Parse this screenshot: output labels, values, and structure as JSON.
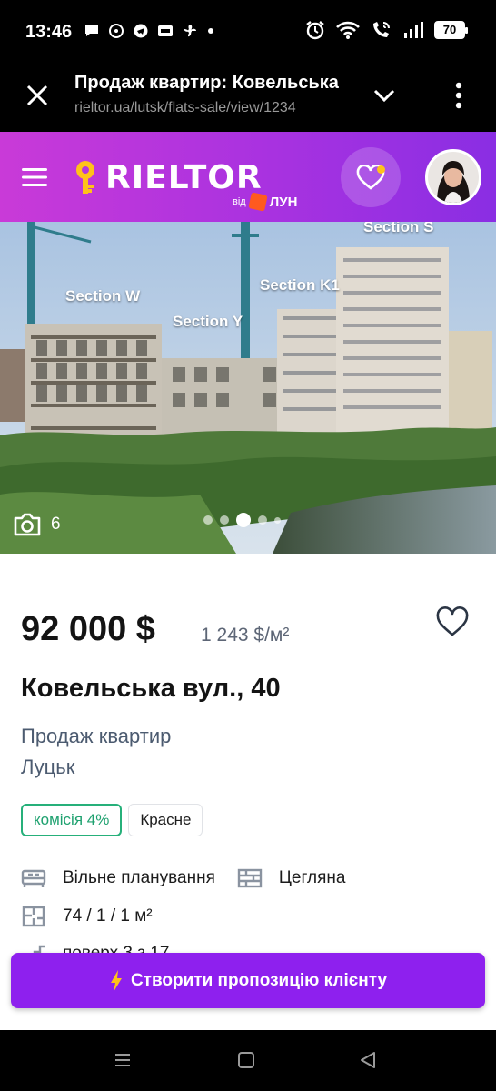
{
  "status_bar": {
    "time": "13:46",
    "battery": "70",
    "left_icons": [
      "chat-bubble-icon",
      "viber-icon",
      "telegram-icon",
      "app-icon",
      "fan-icon",
      "dot-icon"
    ],
    "right_icons": [
      "alarm-icon",
      "wifi-icon",
      "wifi-call-icon",
      "signal-icon"
    ]
  },
  "browser": {
    "title": "Продаж квартир: Ковельська",
    "url": "rieltor.ua/lutsk/flats-sale/view/1234"
  },
  "header": {
    "logo_text": "RIELTOR",
    "logo_sub_prefix": "від",
    "logo_sub_brand": "ЛУН",
    "accent_color": "#a832e0",
    "favorite_dot_color": "#ffc21a"
  },
  "photo": {
    "count": "6",
    "labels": [
      "Section W",
      "Section Y",
      "Section K1",
      "Section S"
    ],
    "active_slide": 3,
    "total_dots": 5
  },
  "listing": {
    "price": "92 000 $",
    "price_per_m2": "1 243  $/м²",
    "address": "Ковельська вул., 40",
    "category": "Продаж квартир",
    "city": "Луцьк",
    "tags": [
      "комісія 4%",
      "Красне"
    ],
    "features": {
      "layout": "Вільне планування",
      "material": "Цегляна",
      "area": "74 / 1 / 1 м²",
      "floor": "поверх 3 з 17"
    }
  },
  "cta": {
    "label": "Створити пропозицію клієнту",
    "color": "#8e20ee"
  }
}
